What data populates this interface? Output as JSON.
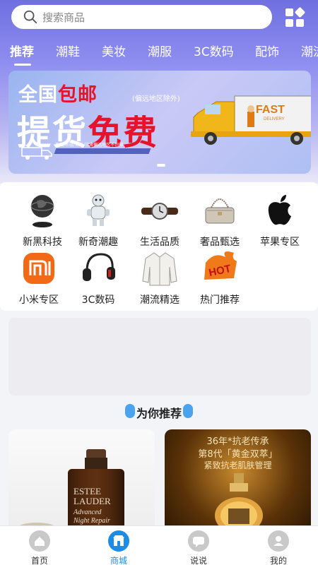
{
  "search": {
    "placeholder": "搜索商品"
  },
  "category_tabs": [
    "推荐",
    "潮鞋",
    "美妆",
    "潮服",
    "3C数码",
    "配饰",
    "潮流"
  ],
  "active_tab": "推荐",
  "banner": {
    "line1_a": "全国",
    "line1_b": "包邮",
    "note": "(偏远地区除外)",
    "line2_a": "提货",
    "line2_b": "免费",
    "truck_brand": "FAST",
    "truck_sub": "DELIVERY",
    "small_text": "西藏/新疆/青海/甘肃偏远地区不包邮"
  },
  "icon_grid": [
    {
      "label": "新黑科技",
      "icon": "globe-levitation-icon"
    },
    {
      "label": "新奇潮趣",
      "icon": "robot-toy-icon"
    },
    {
      "label": "生活品质",
      "icon": "wristwatch-icon"
    },
    {
      "label": "奢品甄选",
      "icon": "handbag-icon"
    },
    {
      "label": "苹果专区",
      "icon": "apple-logo-icon"
    },
    {
      "label": "小米专区",
      "icon": "xiaomi-logo-icon"
    },
    {
      "label": "3C数码",
      "icon": "headphones-icon"
    },
    {
      "label": "潮流精选",
      "icon": "jacket-icon"
    },
    {
      "label": "热门推荐",
      "icon": "hot-badge-icon"
    }
  ],
  "recommend_title": "为你推荐",
  "products": [
    {
      "brand": "ESTEE LAUDER",
      "name": "Advanced Night Repair"
    },
    {
      "line1": "36年*抗老传承",
      "line2": "第8代「黄金双萃」",
      "line3": "紧致抗老肌肤管理"
    }
  ],
  "bottom_nav": [
    {
      "label": "首页",
      "icon": "home-icon"
    },
    {
      "label": "商城",
      "icon": "shop-icon"
    },
    {
      "label": "说说",
      "icon": "chat-icon"
    },
    {
      "label": "我的",
      "icon": "profile-icon"
    }
  ],
  "active_nav": "商城",
  "colors": {
    "accent": "#1b8ce8",
    "banner_red": "#e8132a",
    "header_purple": "#7b7be6"
  }
}
